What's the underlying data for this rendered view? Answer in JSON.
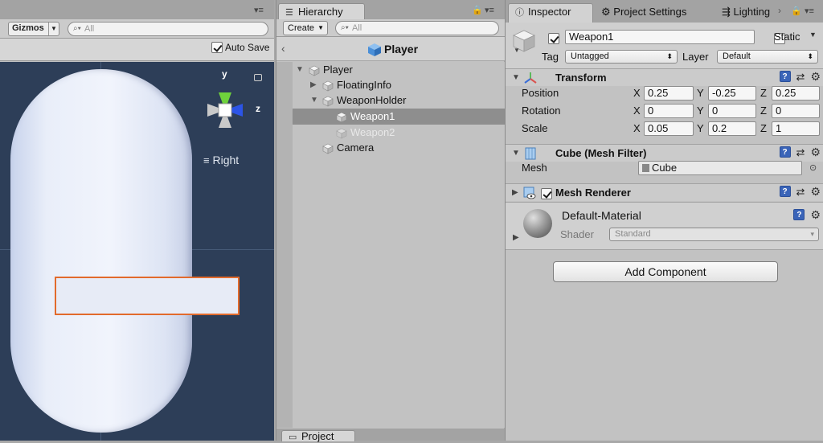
{
  "scene": {
    "gizmos_label": "Gizmos",
    "search_placeholder": "All",
    "autosave_label": "Auto Save",
    "autosave_checked": true,
    "view_label": "Right",
    "axis_y": "y",
    "axis_z": "z"
  },
  "hierarchy": {
    "tab_label": "Hierarchy",
    "create_label": "Create",
    "search_placeholder": "All",
    "scene_title": "Player",
    "items": [
      {
        "label": "Player",
        "depth": 0,
        "expanded": true
      },
      {
        "label": "FloatingInfo",
        "depth": 1,
        "expanded": false
      },
      {
        "label": "WeaponHolder",
        "depth": 1,
        "expanded": true
      },
      {
        "label": "Weapon1",
        "depth": 2,
        "selected": true
      },
      {
        "label": "Weapon2",
        "depth": 2,
        "inactive": true
      },
      {
        "label": "Camera",
        "depth": 1
      }
    ],
    "bottom_tab_label": "Project"
  },
  "inspector": {
    "tabs": [
      "Inspector",
      "Project Settings",
      "Lighting"
    ],
    "object_name": "Weapon1",
    "active_checked": true,
    "static_label": "Static",
    "static_checked": false,
    "tag_label": "Tag",
    "tag_value": "Untagged",
    "layer_label": "Layer",
    "layer_value": "Default",
    "transform": {
      "title": "Transform",
      "position_label": "Position",
      "rotation_label": "Rotation",
      "scale_label": "Scale",
      "position": {
        "x": "0.25",
        "y": "-0.25",
        "z": "0.25"
      },
      "rotation": {
        "x": "0",
        "y": "0",
        "z": "0"
      },
      "scale": {
        "x": "0.05",
        "y": "0.2",
        "z": "1"
      },
      "x": "X",
      "y": "Y",
      "z": "Z"
    },
    "mesh_filter": {
      "title": "Cube (Mesh Filter)",
      "mesh_label": "Mesh",
      "mesh_value": "Cube"
    },
    "mesh_renderer": {
      "title": "Mesh Renderer",
      "enabled": true
    },
    "material": {
      "name": "Default-Material",
      "shader_label": "Shader",
      "shader_value": "Standard"
    },
    "add_component_label": "Add Component"
  },
  "colors": {
    "selection_outline": "#e26a2c",
    "viewport_bg": "#2d3e58",
    "gizmo_y": "#6fd23c",
    "gizmo_z": "#2c54e6",
    "help_icon": "#3a64b8"
  }
}
